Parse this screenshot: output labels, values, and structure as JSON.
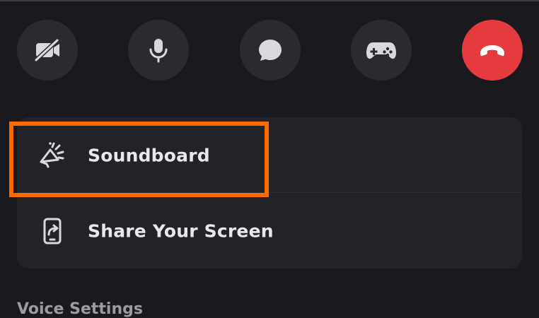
{
  "controls": [
    {
      "name": "camera-off",
      "icon": "camera-off-icon"
    },
    {
      "name": "microphone",
      "icon": "microphone-icon"
    },
    {
      "name": "chat",
      "icon": "chat-bubble-icon"
    },
    {
      "name": "activities",
      "icon": "gamepad-icon"
    },
    {
      "name": "end-call",
      "icon": "phone-hangup-icon",
      "color": "#e53b3f"
    }
  ],
  "menu": {
    "soundboard_label": "Soundboard",
    "share_screen_label": "Share Your Screen"
  },
  "section": {
    "voice_settings_label": "Voice Settings"
  },
  "colors": {
    "background": "#1a1a1e",
    "card": "#222328",
    "control_bg": "#2a2b30",
    "end_call": "#e53b3f",
    "highlight": "#ff6a00"
  }
}
